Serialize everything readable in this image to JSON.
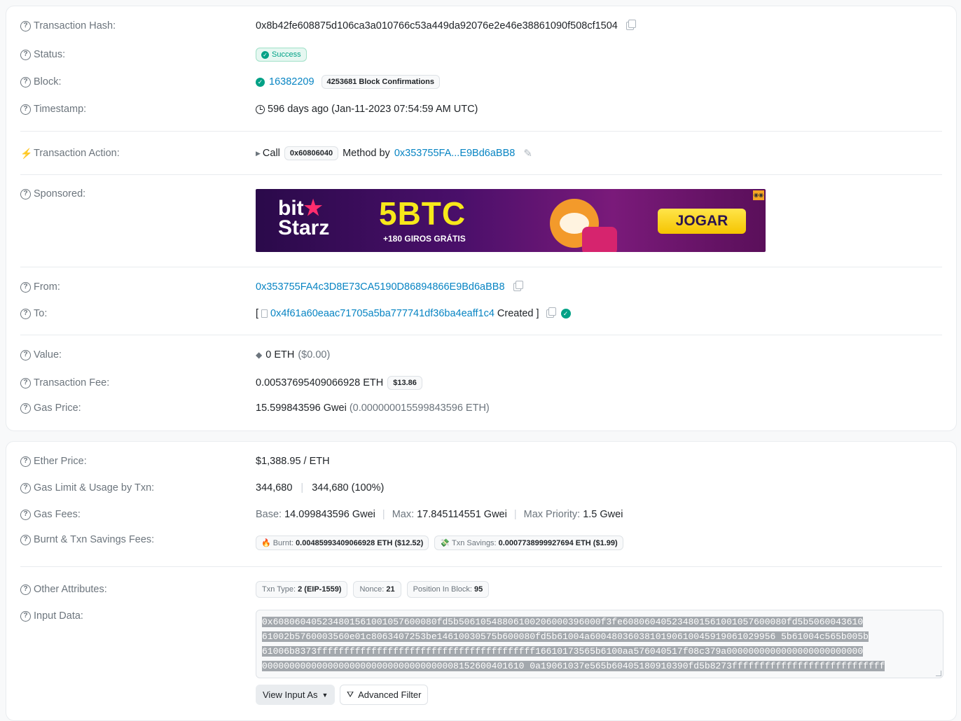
{
  "tx": {
    "hash_label": "Transaction Hash:",
    "hash_value": "0x8b42fe608875d106ca3a010766c53a449da92076e2e46e38861090f508cf1504",
    "status_label": "Status:",
    "status_value": "Success",
    "block_label": "Block:",
    "block_value": "16382209",
    "block_confirmations": "4253681 Block Confirmations",
    "timestamp_label": "Timestamp:",
    "timestamp_value": "596 days ago (Jan-11-2023 07:54:59 AM UTC)",
    "action_label": "Transaction Action:",
    "action_call": "Call",
    "action_method": "0x60806040",
    "action_method_by": "Method by",
    "action_address": "0x353755FA...E9Bd6aBB8",
    "sponsored_label": "Sponsored:",
    "from_label": "From:",
    "from_value": "0x353755FA4c3D8E73CA5190D86894866E9Bd6aBB8",
    "to_label": "To:",
    "to_bracket_open": "[",
    "to_value": "0x4f61a60eaac71705a5ba777741df36ba4eaff1c4",
    "to_created": "Created ]",
    "value_label": "Value:",
    "value_eth": "0 ETH",
    "value_usd": "($0.00)",
    "fee_label": "Transaction Fee:",
    "fee_value": "0.00537695409066928 ETH",
    "fee_usd": "$13.86",
    "gas_price_label": "Gas Price:",
    "gas_price_value": "15.599843596 Gwei",
    "gas_price_eth": "(0.000000015599843596 ETH)"
  },
  "banner": {
    "brand_top": "bit",
    "brand_bottom": "Starz",
    "headline": "5BTC",
    "sub": "+180 GIROS GRÁTIS",
    "cta": "JOGAR"
  },
  "more": {
    "ether_price_label": "Ether Price:",
    "ether_price_value": "$1,388.95 / ETH",
    "gas_limit_label": "Gas Limit & Usage by Txn:",
    "gas_limit_value": "344,680",
    "gas_usage_value": "344,680 (100%)",
    "gas_fees_label": "Gas Fees:",
    "base_label": "Base:",
    "base_value": "14.099843596 Gwei",
    "max_label": "Max:",
    "max_value": "17.845114551 Gwei",
    "max_priority_label": "Max Priority:",
    "max_priority_value": "1.5 Gwei",
    "burnt_label": "Burnt & Txn Savings Fees:",
    "burnt_pill_label": "Burnt:",
    "burnt_pill_value": "0.00485993409066928 ETH ($12.52)",
    "savings_pill_label": "Txn Savings:",
    "savings_pill_value": "0.0007738999927694 ETH ($1.99)",
    "other_label": "Other Attributes:",
    "txn_type_label": "Txn Type:",
    "txn_type_value": "2 (EIP-1559)",
    "nonce_label": "Nonce:",
    "nonce_value": "21",
    "position_label": "Position In Block:",
    "position_value": "95",
    "input_label": "Input Data:",
    "input_lines": [
      "0x608060405234801561001057600080fd5b50610548806100206000396000f3fe608060405234801561001057600080fd5b5060043610",
      "61002b5760003560e01c8063407253be14610030575b600080fd5b61004a6004803603810190610045919061029956 5b61004c565b005b",
      "61006b8373ffffffffffffffffffffffffffffffffffffffff16610173565b6100aa576040517f08c379a0000000000000000000000000",
      "000000000000000000000000000000000008152600401610 0a19061037e565b60405180910390fd5b8273ffffffffffffffffffffffffffff"
    ],
    "view_input_as": "View Input As",
    "advanced_filter": "Advanced Filter"
  }
}
